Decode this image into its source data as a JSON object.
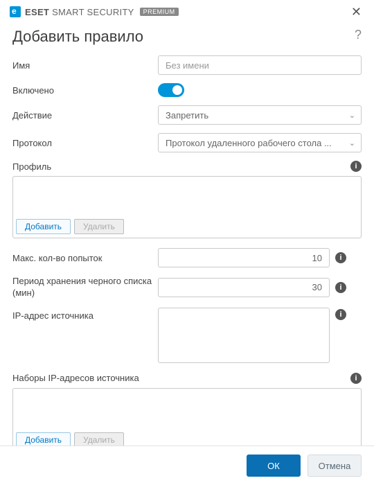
{
  "brand": {
    "prefix": "ESET",
    "name": "SMART SECURITY",
    "badge": "PREMIUM"
  },
  "dialog": {
    "title": "Добавить правило",
    "help_symbol": "?"
  },
  "fields": {
    "name": {
      "label": "Имя",
      "placeholder": "Без имени",
      "value": ""
    },
    "enabled": {
      "label": "Включено",
      "state": true
    },
    "action": {
      "label": "Действие",
      "selected": "Запретить"
    },
    "protocol": {
      "label": "Протокол",
      "selected": "Протокол удаленного рабочего стола ..."
    },
    "profile": {
      "label": "Профиль"
    },
    "max_attempts": {
      "label": "Макс. кол-во попыток",
      "value": "10"
    },
    "blacklist_period": {
      "label": "Период хранения черного списка (мин)",
      "value": "30"
    },
    "source_ip": {
      "label": "IP-адрес источника"
    },
    "source_ip_sets": {
      "label": "Наборы IP-адресов источника"
    }
  },
  "buttons": {
    "add": "Добавить",
    "delete": "Удалить",
    "ok": "ОК",
    "cancel": "Отмена"
  },
  "icons": {
    "info": "i",
    "close": "✕",
    "chevron": "⌄"
  }
}
